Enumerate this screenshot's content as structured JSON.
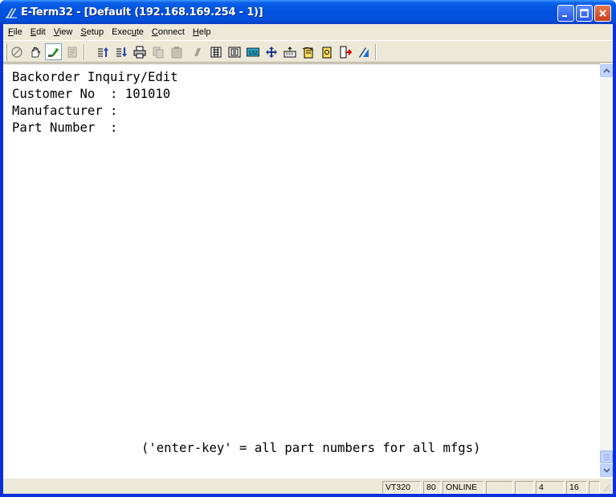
{
  "window": {
    "title": "E-Term32 - [Default (192.168.169.254 - 1)]",
    "colors": {
      "titlebar": "#0353e0",
      "close": "#c9401c",
      "frame": "#ece9d8"
    }
  },
  "menu": {
    "items": [
      {
        "label": "File",
        "access": "F",
        "rest": "ile"
      },
      {
        "label": "Edit",
        "access": "E",
        "rest": "dit"
      },
      {
        "label": "View",
        "access": "V",
        "rest": "iew"
      },
      {
        "label": "Setup",
        "access": "S",
        "rest": "etup"
      },
      {
        "label": "Execute",
        "pre": "Exec",
        "access": "u",
        "rest": "te"
      },
      {
        "label": "Connect",
        "access": "C",
        "rest": "onnect"
      },
      {
        "label": "Help",
        "access": "H",
        "rest": "elp"
      }
    ]
  },
  "toolbar": {
    "icons": [
      "stop-icon",
      "hand-icon",
      "connect-icon",
      "print-dim-icon",
      "upload-icon",
      "download-icon",
      "printer-icon",
      "copy-icon",
      "paste-icon",
      "eraser-icon",
      "screen-icon",
      "screen-alt-icon",
      "columns-132-icon",
      "move-icon",
      "keyboard-icon",
      "exec-script-icon",
      "macro-icon",
      "exit-icon",
      "logo-icon"
    ],
    "col132_label": "132"
  },
  "terminal": {
    "lines": [
      "Backorder Inquiry/Edit",
      "Customer No  : 101010",
      "Manufacturer :",
      "Part Number  :"
    ],
    "hint": "('enter-key' = all part numbers for all mfgs)"
  },
  "status": {
    "emulation": "VT320",
    "columns": "80",
    "state": "ONLINE",
    "blank1": "",
    "blank2": "",
    "row": "4",
    "col": "16",
    "blank3": ""
  }
}
